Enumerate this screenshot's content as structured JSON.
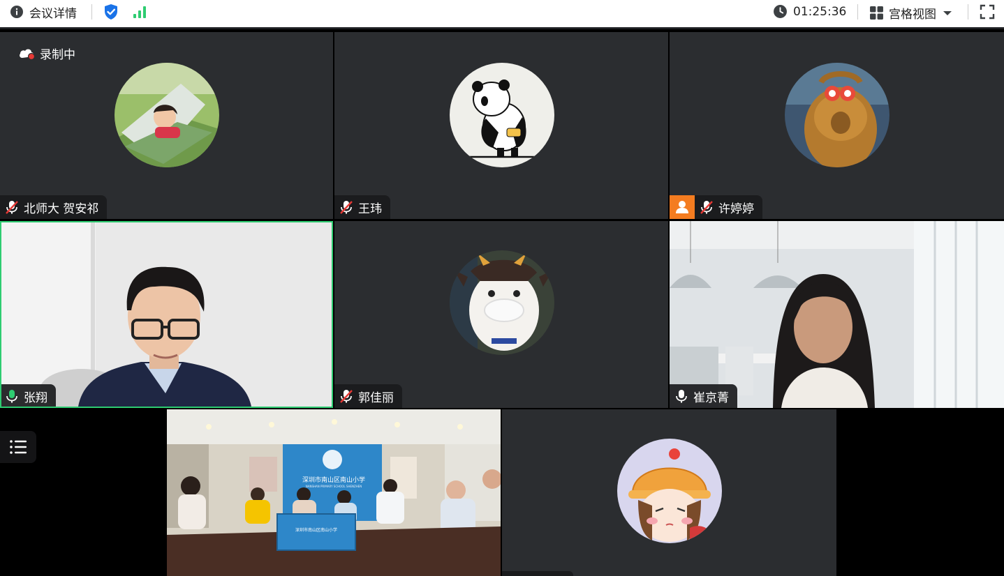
{
  "topbar": {
    "meeting_info_label": "会议详情",
    "timer": "01:25:36",
    "view_label": "宫格视图"
  },
  "recording_label": "录制中",
  "participants": [
    {
      "name": "北师大 贺安祁",
      "mic": "muted"
    },
    {
      "name": "王玮",
      "mic": "muted"
    },
    {
      "name": "许婷婷",
      "mic": "muted",
      "host_badge": true
    },
    {
      "name": "张翔",
      "mic": "speaking",
      "active_speaker": true
    },
    {
      "name": "郭佳丽",
      "mic": "muted"
    },
    {
      "name": "崔京菁",
      "mic": "on"
    }
  ],
  "room_video": {
    "banner_text": "深圳市南山区南山小学",
    "banner_subtext": "NANSHAN PRIMARY SCHOOL  SHENZHEN",
    "desk_sign": "深圳市南山区南山小学"
  },
  "colors": {
    "accent_green": "#2ecc71",
    "muted_red": "#e53935",
    "shield_blue": "#1a73e8",
    "host_orange": "#f47c20"
  }
}
